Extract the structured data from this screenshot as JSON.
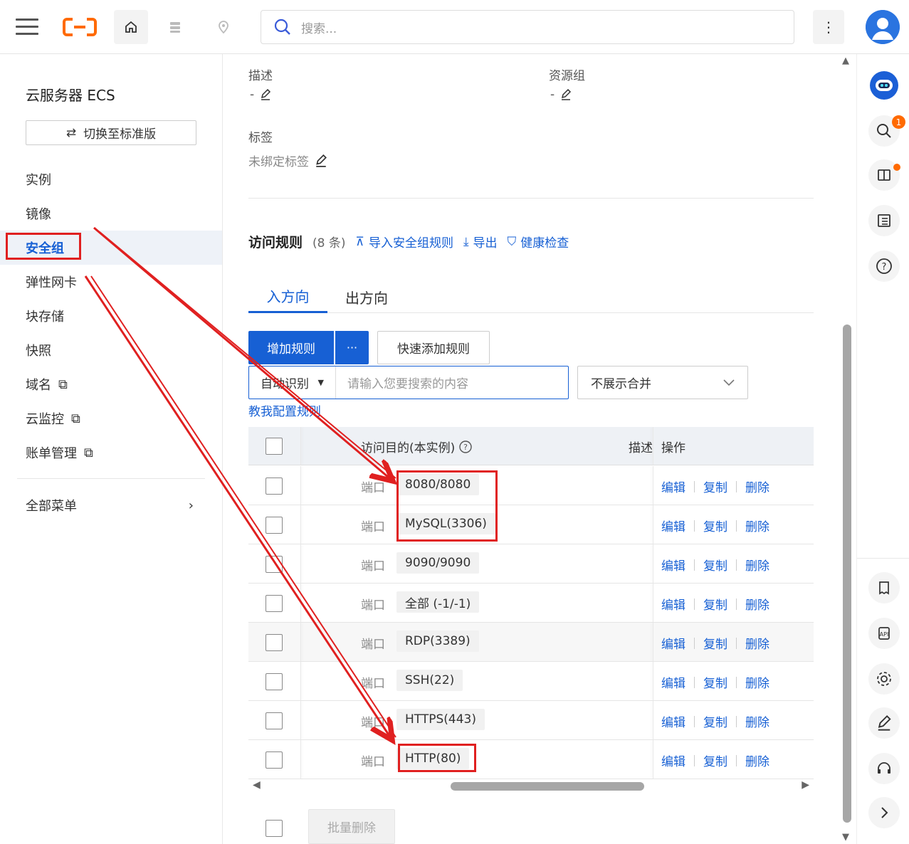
{
  "header": {
    "search_placeholder": "搜索...",
    "more_label": "⋮",
    "icons": [
      "menu-icon",
      "aliyun-logo",
      "home-icon",
      "database-icon",
      "location-icon",
      "search-icon",
      "user-avatar"
    ]
  },
  "sidebar": {
    "title": "云服务器 ECS",
    "switch_label": "切换至标准版",
    "items": [
      {
        "label": "实例"
      },
      {
        "label": "镜像"
      },
      {
        "label": "安全组",
        "active": true
      },
      {
        "label": "弹性网卡"
      },
      {
        "label": "块存储"
      },
      {
        "label": "快照"
      },
      {
        "label": "域名",
        "external": true
      },
      {
        "label": "云监控",
        "external": true
      },
      {
        "label": "账单管理",
        "external": true
      }
    ],
    "all_menu": "全部菜单"
  },
  "details": {
    "desc_label": "描述",
    "desc_value": "-",
    "rg_label": "资源组",
    "rg_value": "-",
    "tag_label": "标签",
    "tag_value": "未绑定标签"
  },
  "rules": {
    "title": "访问规则",
    "count": "(8 条)",
    "import_label": "导入安全组规则",
    "export_label": "导出",
    "health_label": "健康检查",
    "tab_in": "入方向",
    "tab_out": "出方向",
    "add_btn": "增加规则",
    "more_btn": "···",
    "quick_btn": "快速添加规则",
    "search_select": "自动识别",
    "search_placeholder": "请输入您要搜索的内容",
    "merge_select": "不展示合并",
    "teach_link": "教我配置规则",
    "col_dest": "访问目的(本实例)",
    "col_desc": "描述",
    "col_op": "操作",
    "rows": [
      {
        "type": "端口",
        "port": "8080/8080"
      },
      {
        "type": "端口",
        "port": "MySQL(3306)"
      },
      {
        "type": "端口",
        "port": "9090/9090"
      },
      {
        "type": "端口",
        "port": "全部 (-1/-1)"
      },
      {
        "type": "端口",
        "port": "RDP(3389)"
      },
      {
        "type": "端口",
        "port": "SSH(22)"
      },
      {
        "type": "端口",
        "port": "HTTPS(443)"
      },
      {
        "type": "端口",
        "port": "HTTP(80)"
      }
    ],
    "op_edit": "编辑",
    "op_copy": "复制",
    "op_delete": "删除",
    "bulk_delete": "批量删除"
  },
  "rightbar": {
    "badge": "1",
    "icons": [
      "robot-icon",
      "search-icon",
      "book-icon",
      "checklist-icon",
      "help-icon",
      "receipt-icon",
      "api-icon",
      "settings-icon",
      "edit-icon",
      "headset-icon",
      "chevron-right-icon"
    ]
  },
  "colors": {
    "accent": "#1760d4",
    "brand": "#ff6a00",
    "annotation": "#e02020"
  }
}
